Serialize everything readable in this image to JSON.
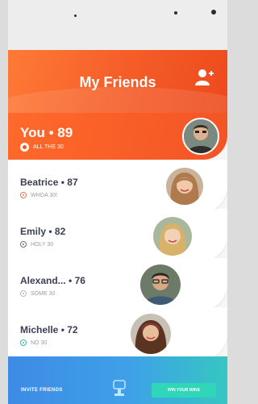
{
  "header": {
    "title": "My Friends"
  },
  "you": {
    "name": "You",
    "score": "89",
    "status": "ALL THE 30",
    "avatar_icon": "person-avatar"
  },
  "friends": [
    {
      "name": "Beatrice",
      "score": "87",
      "status": "WHOA 30!",
      "avatar_icon": "person-avatar"
    },
    {
      "name": "Emily",
      "score": "82",
      "status": "HOLY 30",
      "avatar_icon": "person-avatar"
    },
    {
      "name": "Alexand...",
      "score": "76",
      "status": "SOME 30",
      "avatar_icon": "person-avatar"
    },
    {
      "name": "Michelle",
      "score": "72",
      "status": "NO 30",
      "avatar_icon": "person-avatar"
    }
  ],
  "bottom_bar": {
    "invite_label": "INVITE FRIENDS",
    "win_label": "WIN YOUR WINS"
  },
  "colors": {
    "header_orange": "#f45c28",
    "bar_blue": "#3d8be6",
    "bar_teal": "#2fd6b8"
  }
}
